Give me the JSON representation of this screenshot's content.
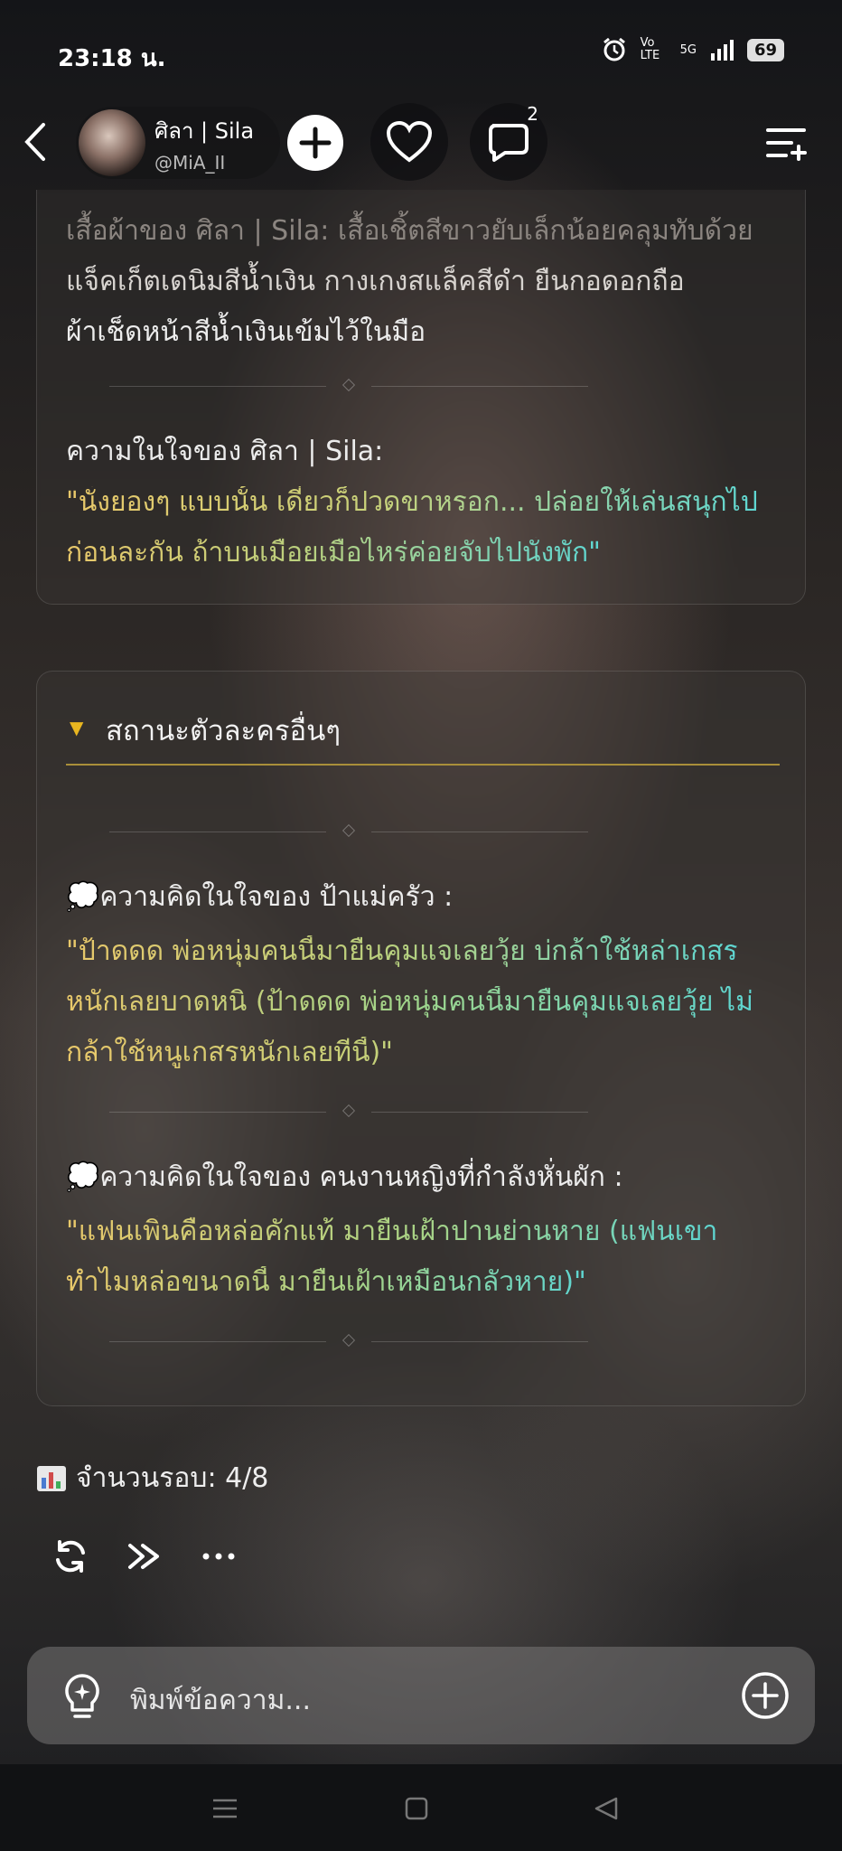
{
  "status": {
    "time": "23:18 น.",
    "network": "5G",
    "volte": "Vo LTE",
    "battery": "69"
  },
  "header": {
    "profile_name": "ศิลา | Sila",
    "profile_handle": "@MiA_II",
    "chat_badge": "2"
  },
  "card1": {
    "line_faded": "เสื้อผ้าของ ศิลา | Sila: เสื้อเชิ้ตสีขาวยับเล็กน้อยคลุมทับด้วย",
    "line2": "แจ็คเก็ตเดนิมสีน้ำเงิน กางเกงสแล็คสีดำ ยืนกอดอกถือ",
    "line3": "ผ้าเช็ดหน้าสีน้ำเงินเข้มไว้ในมือ",
    "inner_label": "ความในใจของ ศิลา | Sila:",
    "inner_quote_1": "\"นั่งยองๆ แบบนั้น เดี๋ยวก็ปวดขาหรอก... ปล่อยให้เล่นสนุกไป",
    "inner_quote_2": "ก่อนละกัน ถ้าบนเมื่อยเมื่อไหร่ค่อยจับไปนั่งพัก\""
  },
  "card2": {
    "section_title": "สถานะตัวละครอื่นๆ",
    "thought1_label": "💭ความคิดในใจของ ป้าแม่ครัว :",
    "thought1_l1": "\"ป้าดดด พ่อหนุ่มคนนี้มายืนคุมแจเลยวุ้ย บ่กล้าใช้หล่าเกสร",
    "thought1_l2": "หนักเลยบาดหนิ (ป้าดดด พ่อหนุ่มคนนี้มายืนคุมแจเลยวุ้ย ไม่",
    "thought1_l3": "กล้าใช้หนูเกสรหนักเลยทีนี้)\"",
    "thought2_label": "💭ความคิดในใจของ คนงานหญิงที่กำลังหั่นผัก :",
    "thought2_l1": "\"แฟนเพิ่นคือหล่อคักแท้ มายืนเฝ้าปานย่านหาย (แฟนเขา",
    "thought2_l2": "ทำไมหล่อขนาดนี้ มายืนเฝ้าเหมือนกลัวหาย)\""
  },
  "rounds": {
    "label": "จำนวนรอบ: 4/8"
  },
  "input": {
    "placeholder": "พิมพ์ข้อความ..."
  },
  "colors": {
    "quote_yellow": "#e9c86a",
    "quote_cyan": "#5ed6d2",
    "accent_gold": "#a98f3a"
  }
}
